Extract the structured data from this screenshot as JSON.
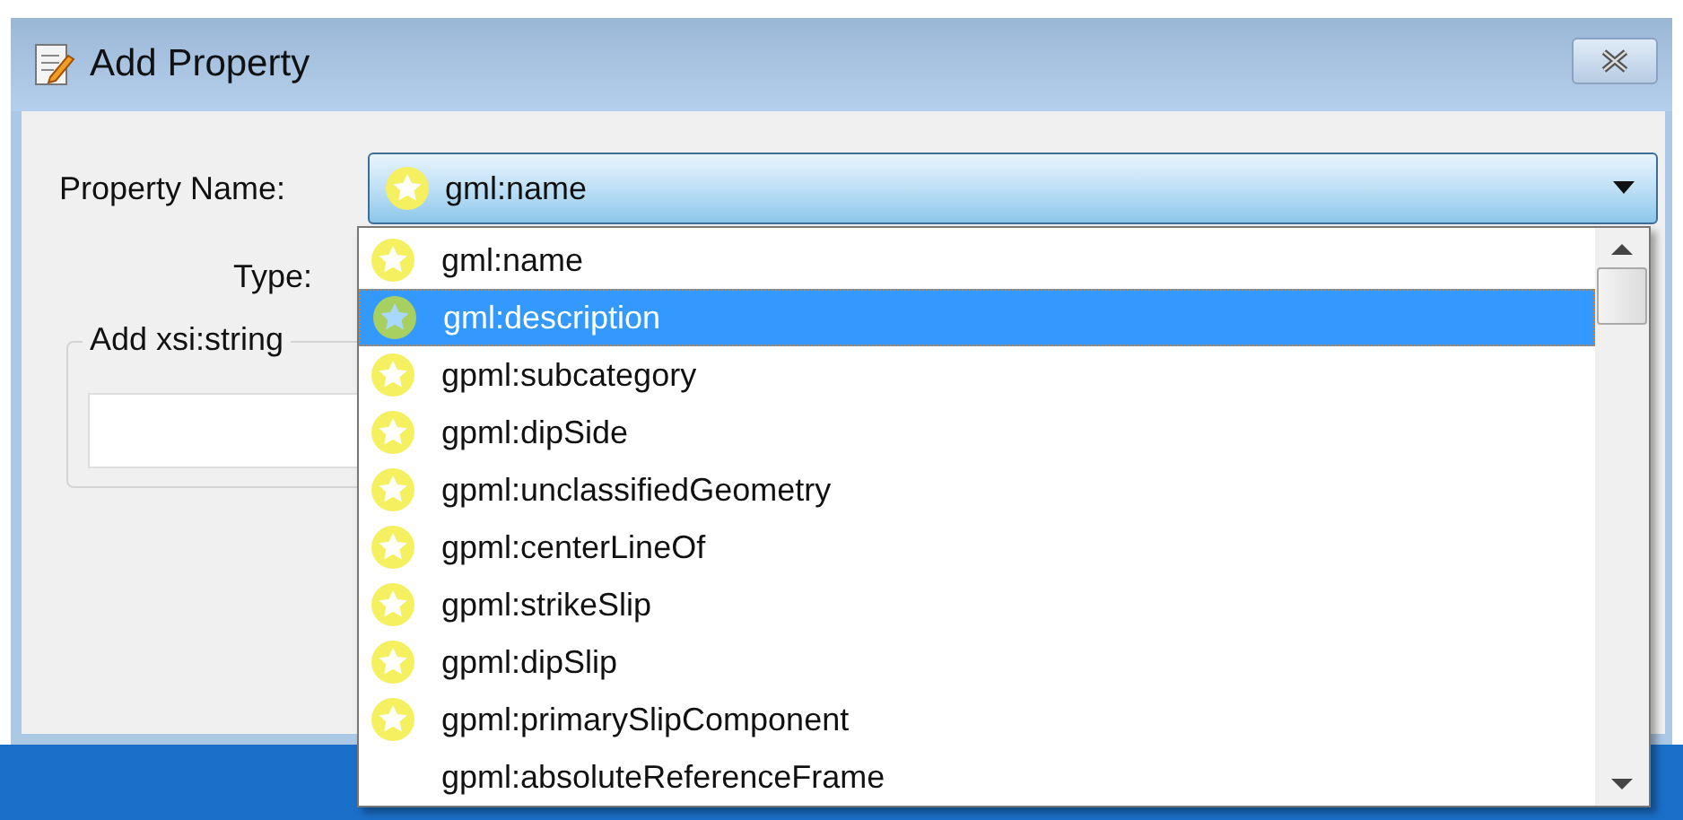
{
  "window": {
    "title": "Add Property"
  },
  "form": {
    "property_name_label": "Property Name:",
    "property_name_value": "gml:name",
    "type_label": "Type:",
    "group_label": "Add xsi:string"
  },
  "dropdown": {
    "items": [
      {
        "label": "gml:name",
        "selected": false,
        "has_icon": true
      },
      {
        "label": "gml:description",
        "selected": true,
        "has_icon": true
      },
      {
        "label": "gpml:subcategory",
        "selected": false,
        "has_icon": true
      },
      {
        "label": "gpml:dipSide",
        "selected": false,
        "has_icon": true
      },
      {
        "label": "gpml:unclassifiedGeometry",
        "selected": false,
        "has_icon": true
      },
      {
        "label": "gpml:centerLineOf",
        "selected": false,
        "has_icon": true
      },
      {
        "label": "gpml:strikeSlip",
        "selected": false,
        "has_icon": true
      },
      {
        "label": "gpml:dipSlip",
        "selected": false,
        "has_icon": true
      },
      {
        "label": "gpml:primarySlipComponent",
        "selected": false,
        "has_icon": true
      },
      {
        "label": "gpml:absoluteReferenceFrame",
        "selected": false,
        "has_icon": false
      }
    ]
  }
}
